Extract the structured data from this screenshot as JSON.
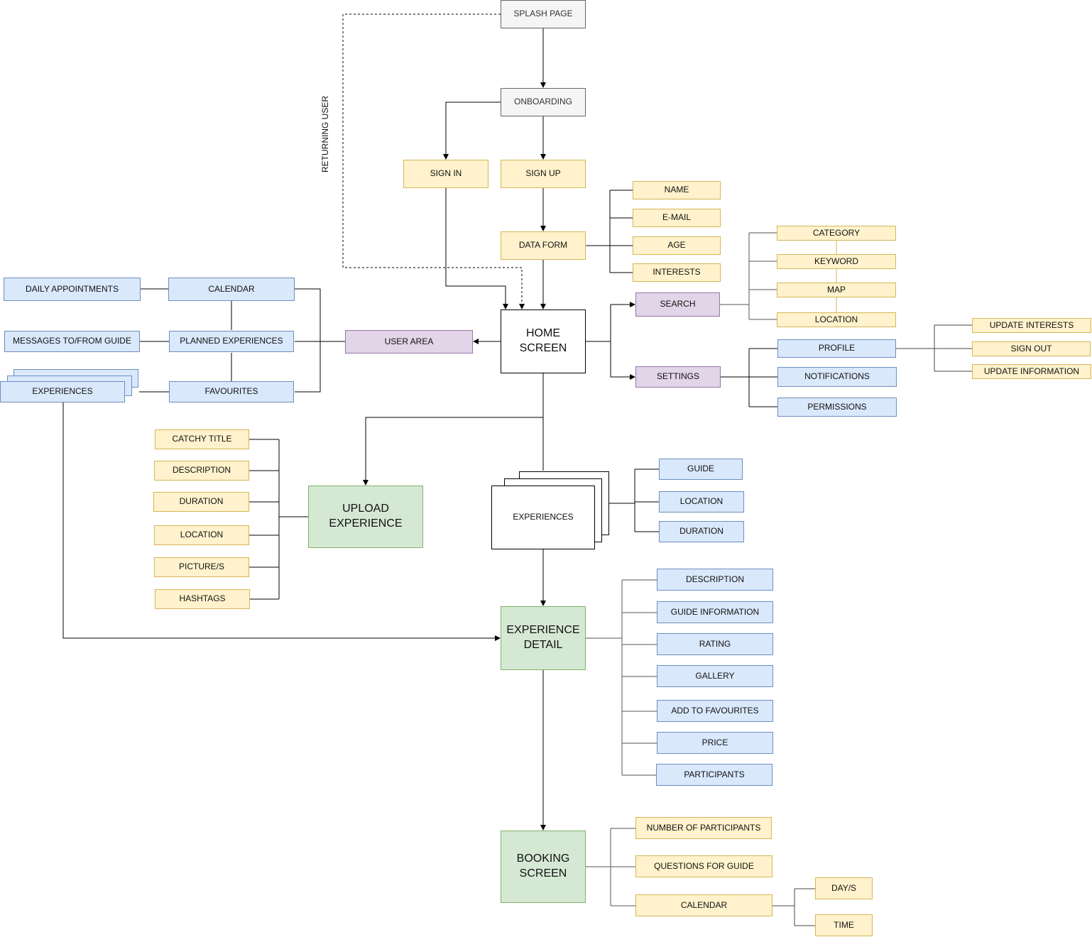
{
  "diagram": {
    "annotation": "RETURNING USER",
    "flow": {
      "splash": "SPLASH PAGE",
      "onboarding": "ONBOARDING",
      "sign_in": "SIGN IN",
      "sign_up": "SIGN UP",
      "data_form": "DATA FORM",
      "home": "HOME SCREEN",
      "user_area": "USER AREA",
      "search": "SEARCH",
      "settings": "SETTINGS",
      "upload": "UPLOAD EXPERIENCE",
      "experiences": "EXPERIENCES",
      "experience_detail": "EXPERIENCE DETAIL",
      "booking": "BOOKING SCREEN"
    },
    "data_form_fields": [
      "NAME",
      "E-MAIL",
      "AGE",
      "INTERESTS"
    ],
    "search_options": [
      "CATEGORY",
      "KEYWORD",
      "MAP",
      "LOCATION"
    ],
    "settings_options": [
      "PROFILE",
      "NOTIFICATIONS",
      "PERMISSIONS"
    ],
    "profile_options": [
      "UPDATE INTERESTS",
      "SIGN OUT",
      "UPDATE INFORMATION"
    ],
    "user_area": {
      "calendar": "CALENDAR",
      "planned": "PLANNED EXPERIENCES",
      "favourites": "FAVOURITES",
      "daily": "DAILY APPOINTMENTS",
      "messages": "MESSAGES TO/FROM GUIDE",
      "experiences": "EXPERIENCES"
    },
    "upload_fields": [
      "CATCHY TITLE",
      "DESCRIPTION",
      "DURATION",
      "LOCATION",
      "PICTURE/S",
      "HASHTAGS"
    ],
    "experience_attrs": [
      "GUIDE",
      "LOCATION",
      "DURATION"
    ],
    "detail_fields": [
      "DESCRIPTION",
      "GUIDE INFORMATION",
      "RATING",
      "GALLERY",
      "ADD TO FAVOURITES",
      "PRICE",
      "PARTICIPANTS"
    ],
    "booking_fields": [
      "NUMBER OF PARTICIPANTS",
      "QUESTIONS FOR GUIDE",
      "CALENDAR"
    ],
    "calendar_fields": [
      "DAY/S",
      "TIME"
    ]
  }
}
